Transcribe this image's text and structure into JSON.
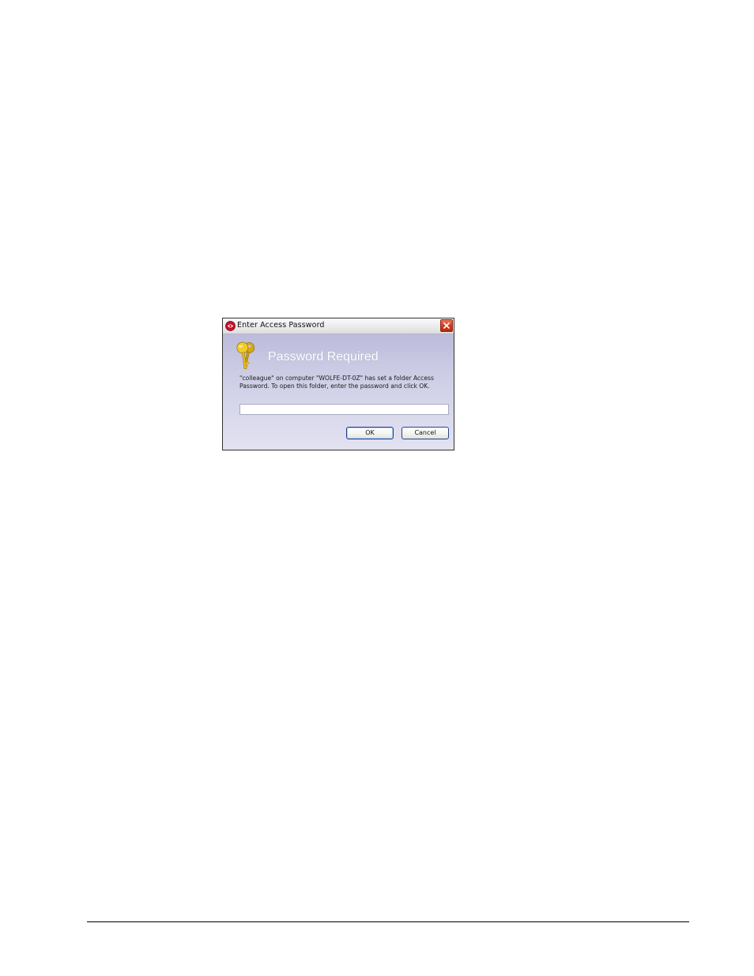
{
  "dialog": {
    "title": "Enter Access Password",
    "heading": "Password Required",
    "message": "\"colleague\" on computer \"WOLFE-DT-0Z\" has set a folder Access Password.  To open this folder, enter the password and click OK.",
    "password_value": "",
    "ok_label": "OK",
    "cancel_label": "Cancel"
  },
  "icons": {
    "app": "app-logo-icon",
    "close": "close-icon",
    "keys": "keys-icon"
  },
  "colors": {
    "dialog_background": "#c9c9e3",
    "heading_text": "#ffffff",
    "close_button": "#cf3a1c",
    "key_gold": "#e8c020"
  }
}
